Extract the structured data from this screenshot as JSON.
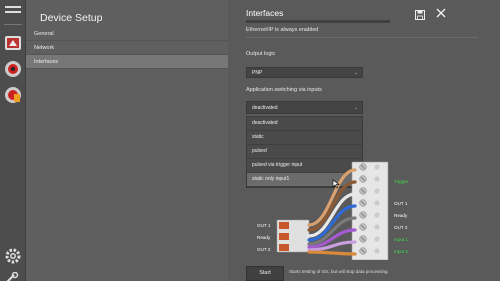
{
  "nav": {
    "title": "Device Setup",
    "items": [
      {
        "label": "General"
      },
      {
        "label": "Network"
      },
      {
        "label": "Interfaces"
      }
    ]
  },
  "main": {
    "title": "Interfaces",
    "info": "Ethernet/IP is always enabled",
    "output_logic_label": "Output logic",
    "output_logic_value": "PNP",
    "app_switching_label": "Application switching via inputs",
    "app_switching_value": "deactivated",
    "dropdown_options": [
      "deactivated",
      "static",
      "pulsed",
      "pulsed via trigger input",
      "static only input1"
    ],
    "hovered_option": "static only input1"
  },
  "wiring": {
    "left_labels": [
      "OUT 1",
      "Ready",
      "OUT 2"
    ],
    "right_labels": [
      {
        "text": "Trigger",
        "color": "green"
      },
      {
        "text": "OUT 1",
        "color": "white"
      },
      {
        "text": "Ready",
        "color": "white"
      },
      {
        "text": "OUT 2",
        "color": "white"
      },
      {
        "text": "Input 1",
        "color": "green"
      },
      {
        "text": "Input 2",
        "color": "green"
      }
    ]
  },
  "footer": {
    "start_label": "Start",
    "start_note": "Starts testing of IOs, but will stop data processing."
  },
  "colors": {
    "accent_green": "#3ddc50",
    "active_nav": "#777777"
  }
}
